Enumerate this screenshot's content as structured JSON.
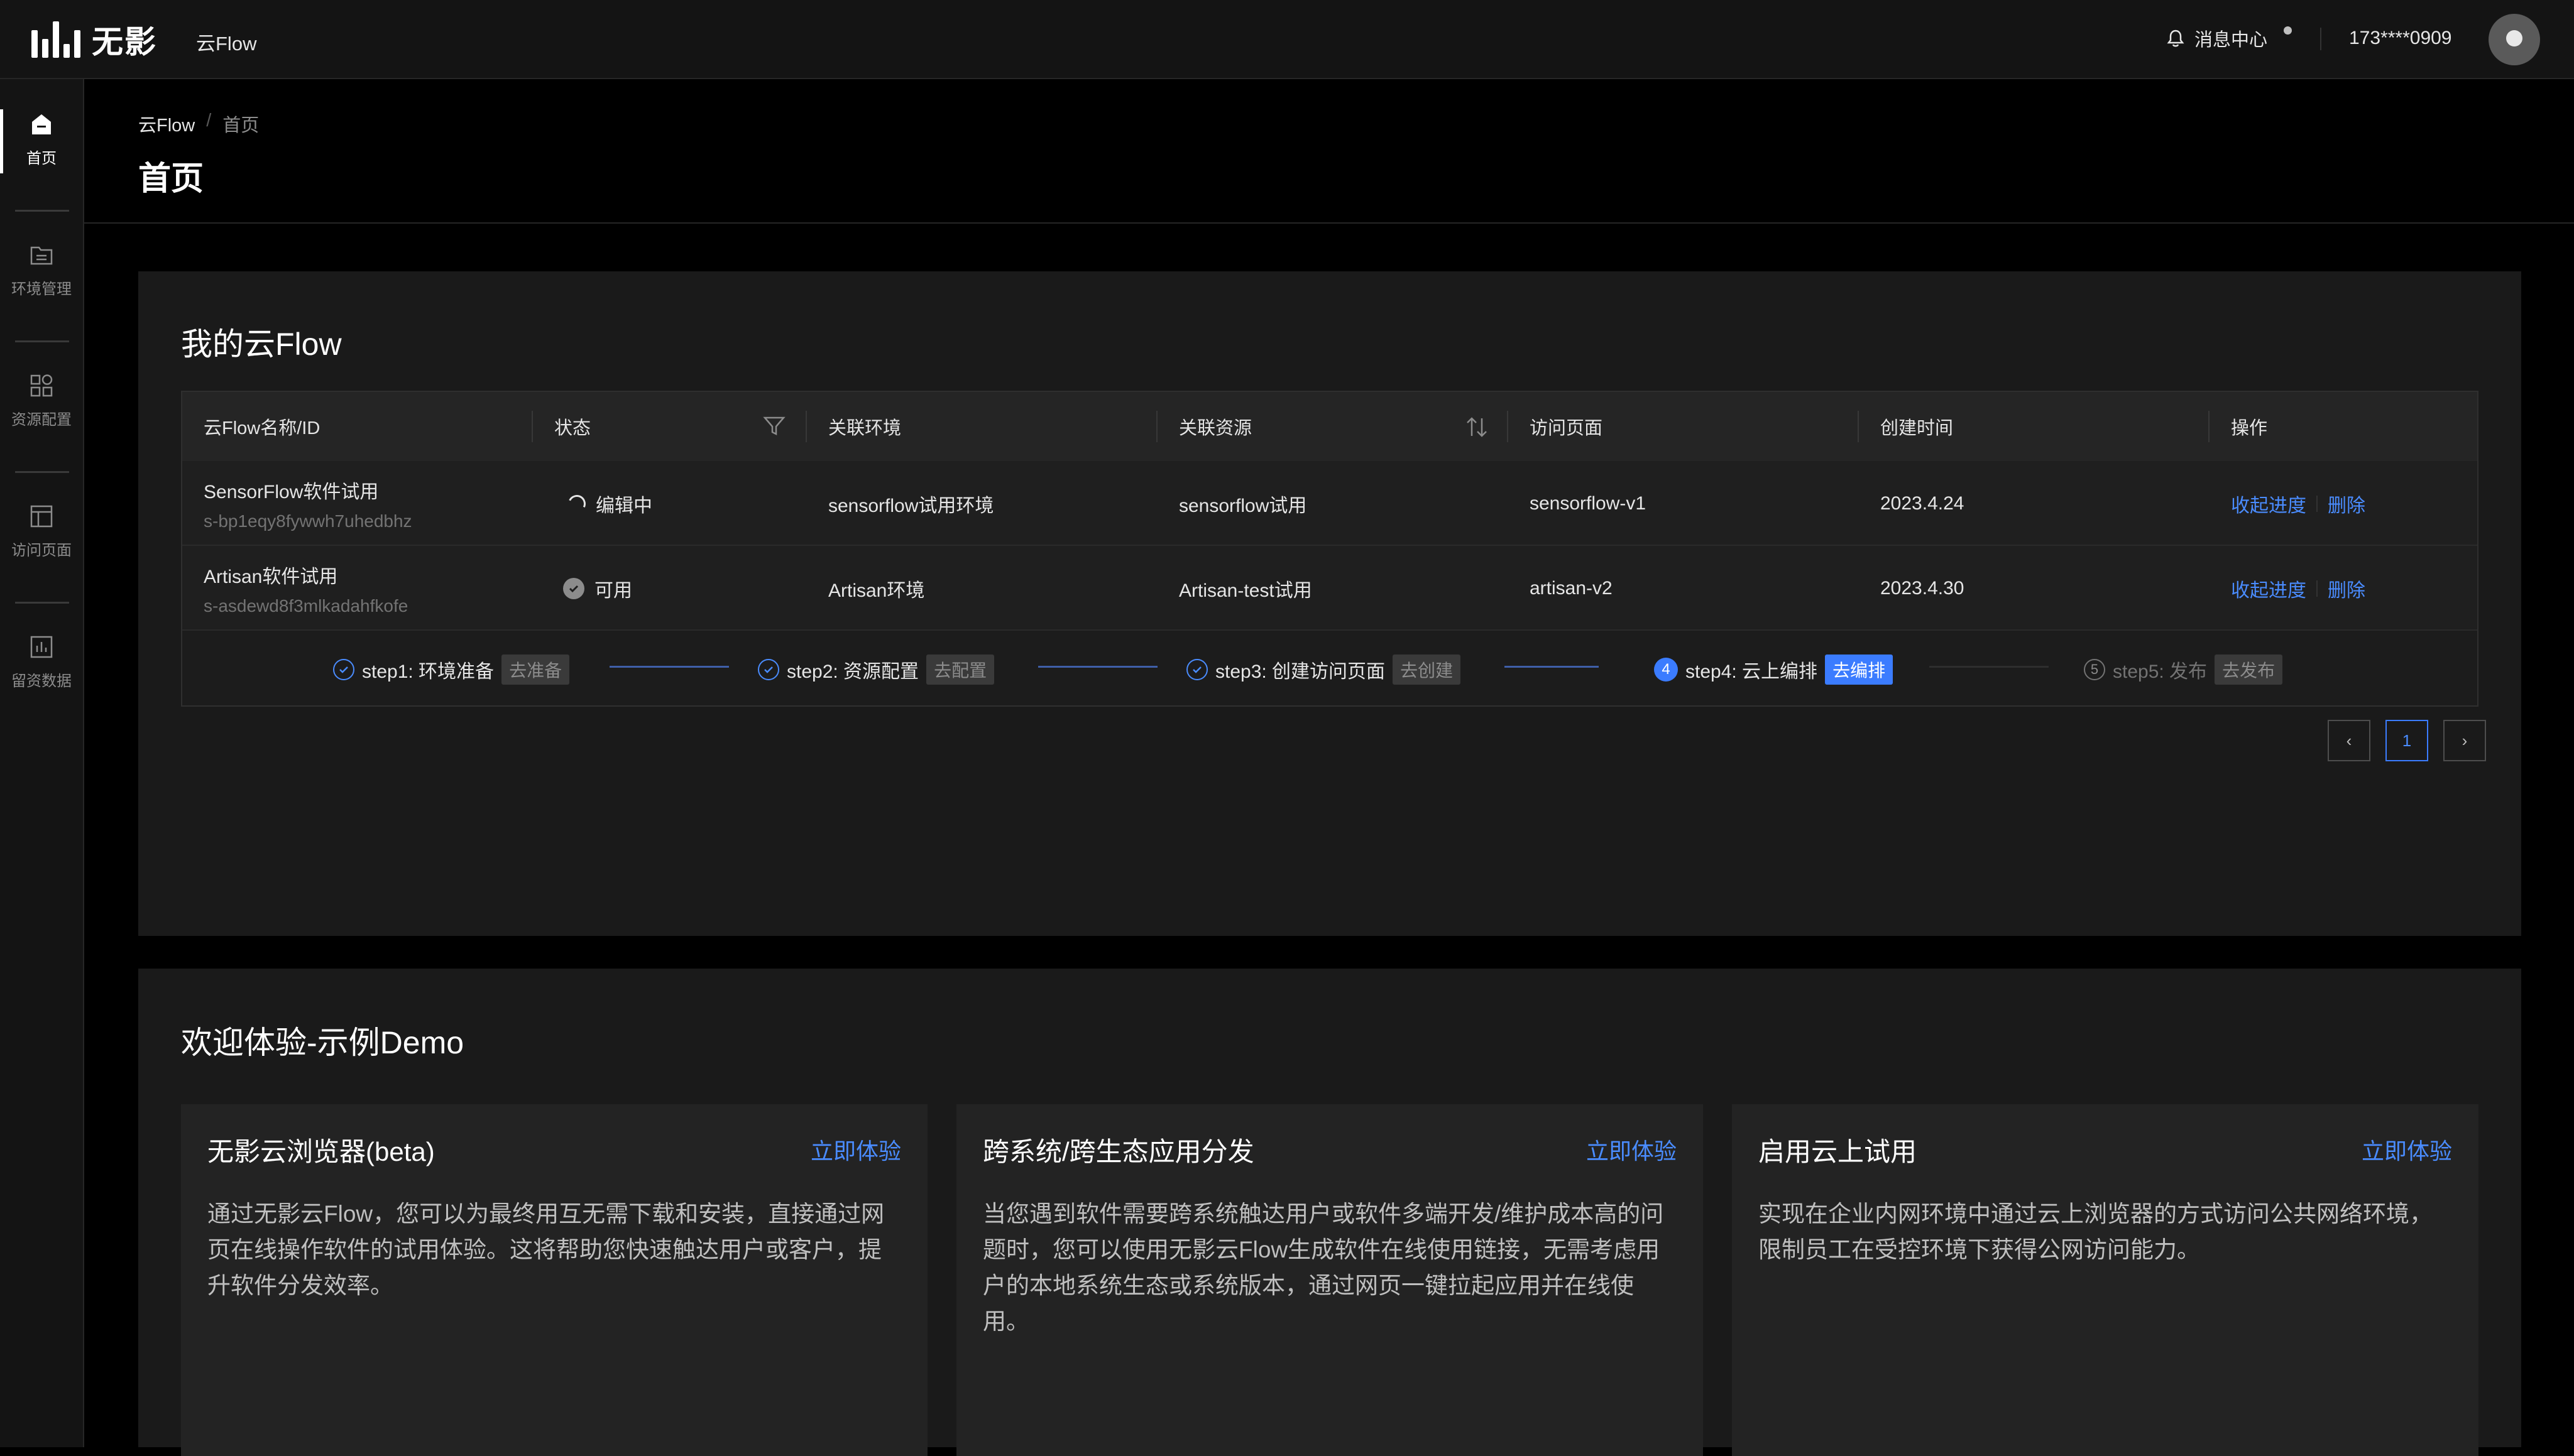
{
  "app": {
    "logo_text": "无影",
    "product": "云Flow",
    "message_center": "消息中心",
    "phone": "173****0909",
    "icons": {
      "bell": "bell-icon",
      "avatar": "user-avatar"
    }
  },
  "sidebar": {
    "items": [
      {
        "label": "首页",
        "icon": "home-icon",
        "active": true
      },
      {
        "label": "环境管理",
        "icon": "folder-icon",
        "active": false
      },
      {
        "label": "资源配置",
        "icon": "grid-icon",
        "active": false
      },
      {
        "label": "访问页面",
        "icon": "layout-icon",
        "active": false
      },
      {
        "label": "留资数据",
        "icon": "bar-chart-icon",
        "active": false
      }
    ]
  },
  "breadcrumb": {
    "root": "云Flow",
    "separator": "/",
    "current": "首页"
  },
  "page_title": "首页",
  "my_flow": {
    "title": "我的云Flow",
    "columns": [
      "云Flow名称/ID",
      "状态",
      "关联环境",
      "关联资源",
      "访问页面",
      "创建时间",
      "操作"
    ],
    "rows": [
      {
        "name": "SensorFlow软件试用",
        "id": "s-bp1eqy8fywwh7uhedbhz",
        "status": "编辑中",
        "env": "sensorflow试用环境",
        "resource": "sensorflow试用",
        "page": "sensorflow-v1",
        "created": "2023.4.24",
        "action_progress": "收起进度",
        "action_delete": "删除"
      },
      {
        "name": "Artisan软件试用",
        "id": "s-asdewd8f3mlkadahfkofe",
        "status": "可用",
        "env": "Artisan环境",
        "resource": "Artisan-test试用",
        "page": "artisan-v2",
        "created": "2023.4.30",
        "action_progress": "收起进度",
        "action_delete": "删除"
      }
    ],
    "steps": [
      {
        "label": "step1: 环境准备",
        "action": "去准备",
        "state": "done"
      },
      {
        "label": "step2: 资源配置",
        "action": "去配置",
        "state": "done"
      },
      {
        "label": "step3: 创建访问页面",
        "action": "去创建",
        "state": "done"
      },
      {
        "label": "step4: 云上编排",
        "action": "去编排",
        "state": "current",
        "num": "4"
      },
      {
        "label": "step5: 发布",
        "action": "去发布",
        "state": "pending",
        "num": "5"
      }
    ],
    "pagination": {
      "prev": "‹",
      "page": "1",
      "next": "›"
    }
  },
  "demo": {
    "title": "欢迎体验-示例Demo",
    "cards": [
      {
        "title": "无影云浏览器(beta)",
        "link": "立即体验",
        "desc": "通过无影云Flow，您可以为最终用互无需下载和安装，直接通过网页在线操作软件的试用体验。这将帮助您快速触达用户或客户，提升软件分发效率。"
      },
      {
        "title": "跨系统/跨生态应用分发",
        "link": "立即体验",
        "desc": "当您遇到软件需要跨系统触达用户或软件多端开发/维护成本高的问题时，您可以使用无影云Flow生成软件在线使用链接，无需考虑用户的本地系统生态或系统版本，通过网页一键拉起应用并在线使用。"
      },
      {
        "title": "启用云上试用",
        "link": "立即体验",
        "desc": "实现在企业内网环境中通过云上浏览器的方式访问公共网络环境，限制员工在受控环境下获得公网访问能力。"
      }
    ]
  },
  "colors": {
    "accent": "#3b7cff",
    "link": "#4a8cff",
    "bg": "#000000",
    "panel": "#1a1a1a"
  }
}
